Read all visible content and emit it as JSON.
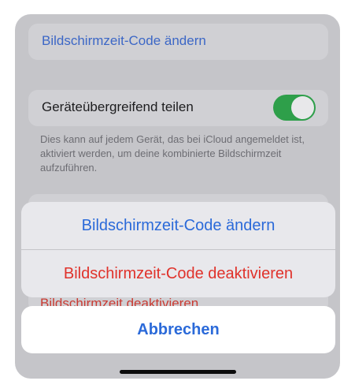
{
  "background": {
    "change_code_label": "Bildschirmzeit-Code ändern",
    "share_label": "Geräteübergreifend teilen",
    "share_toggle_on": true,
    "share_footer": "Dies kann auf jedem Gerät, das bei iCloud angemeldet ist, aktiviert werden, um deine kombinierte Bildschirmzeit aufzuführen.",
    "disable_label": "Bildschirmzeit deaktivieren"
  },
  "action_sheet": {
    "change_code": "Bildschirmzeit-Code ändern",
    "deactivate_code": "Bildschirmzeit-Code deaktivieren",
    "cancel": "Abbrechen"
  },
  "colors": {
    "accent_blue": "#2b6ad9",
    "destructive_red": "#e0322b",
    "toggle_green": "#2e9f4a"
  }
}
